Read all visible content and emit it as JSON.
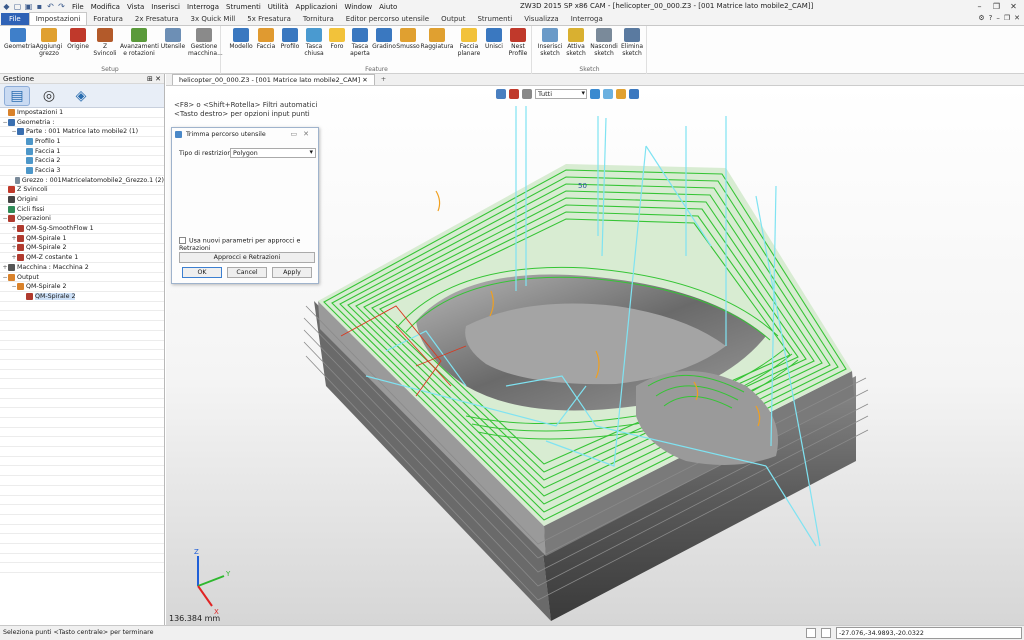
{
  "window": {
    "title": "ZW3D 2015 SP x86     CAM - [helicopter_00_000.Z3 - [001 Matrice lato mobile2_CAM]]",
    "menu": [
      "File",
      "Modifica",
      "Vista",
      "Inserisci",
      "Interroga",
      "Strumenti",
      "Utilità",
      "Applicazioni",
      "Window",
      "Aiuto"
    ]
  },
  "ribbon": {
    "tabs": [
      "File",
      "Impostazioni",
      "Foratura",
      "2x Fresatura",
      "3x Quick Mill",
      "5x Fresatura",
      "Tornitura",
      "Editor percorso utensile",
      "Output",
      "Strumenti",
      "Visualizza",
      "Interroga"
    ],
    "active_tab": "Impostazioni",
    "groups": {
      "setup": {
        "label": "Setup",
        "buttons": [
          "Geometria",
          "Aggiungi grezzo",
          "Origine",
          "Z Svincoli",
          "Avanzamenti e rotazioni",
          "Utensile",
          "Gestione macchina..."
        ]
      },
      "feature": {
        "label": "Feature",
        "buttons": [
          "Modello",
          "Faccia",
          "Profilo",
          "Tasca chiusa",
          "Foro",
          "Tasca aperta",
          "Gradino",
          "Smusso",
          "Raggiatura",
          "Faccia planare",
          "Unisci",
          "Nest Profile"
        ]
      },
      "sketch": {
        "label": "Sketch",
        "buttons": [
          "Inserisci sketch",
          "Attiva sketch",
          "Nascondi sketch",
          "Elimina sketch"
        ]
      }
    }
  },
  "left_panel": {
    "title": "Gestione",
    "tree": [
      {
        "label": "Impostazioni 1",
        "indent": 0,
        "expander": "",
        "color": "#d9822b"
      },
      {
        "label": "Geometria :",
        "indent": 0,
        "expander": "−",
        "color": "#3a6fb0"
      },
      {
        "label": "Parte : 001 Matrice lato mobile2 (1)",
        "indent": 1,
        "expander": "−",
        "color": "#3a6fb0"
      },
      {
        "label": "Profilo 1",
        "indent": 2,
        "expander": "",
        "color": "#4d97c9"
      },
      {
        "label": "Faccia 1",
        "indent": 2,
        "expander": "",
        "color": "#4d97c9"
      },
      {
        "label": "Faccia 2",
        "indent": 2,
        "expander": "",
        "color": "#4d97c9"
      },
      {
        "label": "Faccia 3",
        "indent": 2,
        "expander": "",
        "color": "#4d97c9"
      },
      {
        "label": "Grezzo : 001Matricelatomobile2_Grezzo.1 (2)",
        "indent": 1,
        "expander": "",
        "color": "#7a8a9a"
      },
      {
        "label": "Z Svincoli",
        "indent": 0,
        "expander": "",
        "color": "#c0392b"
      },
      {
        "label": "Origini",
        "indent": 0,
        "expander": "",
        "color": "#444444"
      },
      {
        "label": "Cicli fissi",
        "indent": 0,
        "expander": "",
        "color": "#2e8b57"
      },
      {
        "label": "Operazioni",
        "indent": 0,
        "expander": "−",
        "color": "#b03a2e"
      },
      {
        "label": "QM-Sg-SmoothFlow 1",
        "indent": 1,
        "expander": "+",
        "color": "#b03a2e"
      },
      {
        "label": "QM-Spirale 1",
        "indent": 1,
        "expander": "+",
        "color": "#b03a2e"
      },
      {
        "label": "QM-Spirale 2",
        "indent": 1,
        "expander": "+",
        "color": "#b03a2e"
      },
      {
        "label": "QM-Z costante 1",
        "indent": 1,
        "expander": "+",
        "color": "#b03a2e"
      },
      {
        "label": "Macchina : Macchina 2",
        "indent": 0,
        "expander": "+",
        "color": "#555555"
      },
      {
        "label": "Output",
        "indent": 0,
        "expander": "−",
        "color": "#d9822b"
      },
      {
        "label": "QM-Spirale 2",
        "indent": 1,
        "expander": "−",
        "color": "#d9822b"
      },
      {
        "label": "QM-Spirale 2",
        "indent": 2,
        "expander": "",
        "color": "#b03a2e",
        "selected": true
      }
    ]
  },
  "document": {
    "tab": "helicopter_00_000.Z3 - [001 Matrice lato mobile2_CAM]",
    "add_tab": "+"
  },
  "viewport": {
    "hint_line1": "<F8> o <Shift+Rotella> Filtri automatici",
    "hint_line2": "<Tasto destro> per opzioni input punti",
    "filter": "Tutti",
    "distance": "136.384 mm",
    "axes": {
      "x": "X",
      "y": "Y",
      "z": "Z"
    },
    "model_label": "50"
  },
  "dialog": {
    "title": "Trimma percorso utensile",
    "restriction_label": "Tipo di restrizione",
    "restriction_value": "Polygon",
    "checkbox_label": "Usa nuovi parametri per approcci e Retrazioni",
    "approach_button": "Approcci e Retrazioni",
    "ok": "OK",
    "cancel": "Cancel",
    "apply": "Apply"
  },
  "statusbar": {
    "message": "Seleziona punti <Tasto centrale> per terminare",
    "coordinates": "-27.076,-34.9893,-20.0322"
  }
}
